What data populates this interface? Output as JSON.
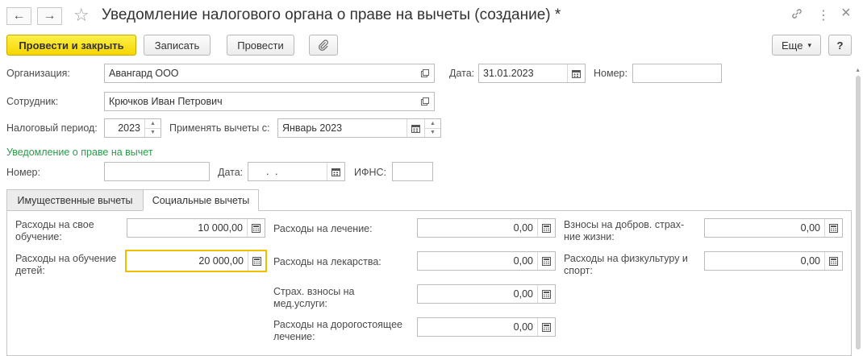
{
  "window": {
    "title": "Уведомление налогового органа о праве на вычеты (создание) *",
    "back_icon": "←",
    "forward_icon": "→",
    "star_icon": "☆",
    "link_icon": "🔗",
    "more_icon": "⋮",
    "close_icon": "×"
  },
  "toolbar": {
    "post_and_close": "Провести и закрыть",
    "save": "Записать",
    "post": "Провести",
    "more": "Еще",
    "more_arrow": "▾",
    "help": "?"
  },
  "form": {
    "organization_label": "Организация:",
    "organization_value": "Авангард ООО",
    "date_label": "Дата:",
    "date_value": "31.01.2023",
    "number_label": "Номер:",
    "number_value": "",
    "employee_label": "Сотрудник:",
    "employee_value": "Крючков Иван Петрович",
    "tax_period_label": "Налоговый период:",
    "tax_period_value": "2023",
    "apply_from_label": "Применять вычеты с:",
    "apply_from_value": "Январь 2023"
  },
  "notice": {
    "section_title": "Уведомление о праве на вычет",
    "number_label": "Номер:",
    "number_value": "",
    "date_label": "Дата:",
    "date_value": ". .",
    "ifns_label": "ИФНС:",
    "ifns_value": ""
  },
  "tabs": {
    "property": "Имущественные вычеты",
    "social": "Социальные вычеты"
  },
  "social": {
    "own_education_label": "Расходы на свое обучение:",
    "own_education_value": "10 000,00",
    "children_education_label": "Расходы на обучение детей:",
    "children_education_value": "20 000,00",
    "treatment_label": "Расходы на лечение:",
    "treatment_value": "0,00",
    "medicines_label": "Расходы на лекарства:",
    "medicines_value": "0,00",
    "med_insurance_label": "Страх. взносы на мед.услуги:",
    "med_insurance_value": "0,00",
    "expensive_treatment_label": "Расходы на дорогостоящее лечение:",
    "expensive_treatment_value": "0,00",
    "life_insurance_label": "Взносы на добров. страх-ние жизни:",
    "life_insurance_value": "0,00",
    "sport_label": "Расходы на физкультуру и спорт:",
    "sport_value": "0,00"
  }
}
